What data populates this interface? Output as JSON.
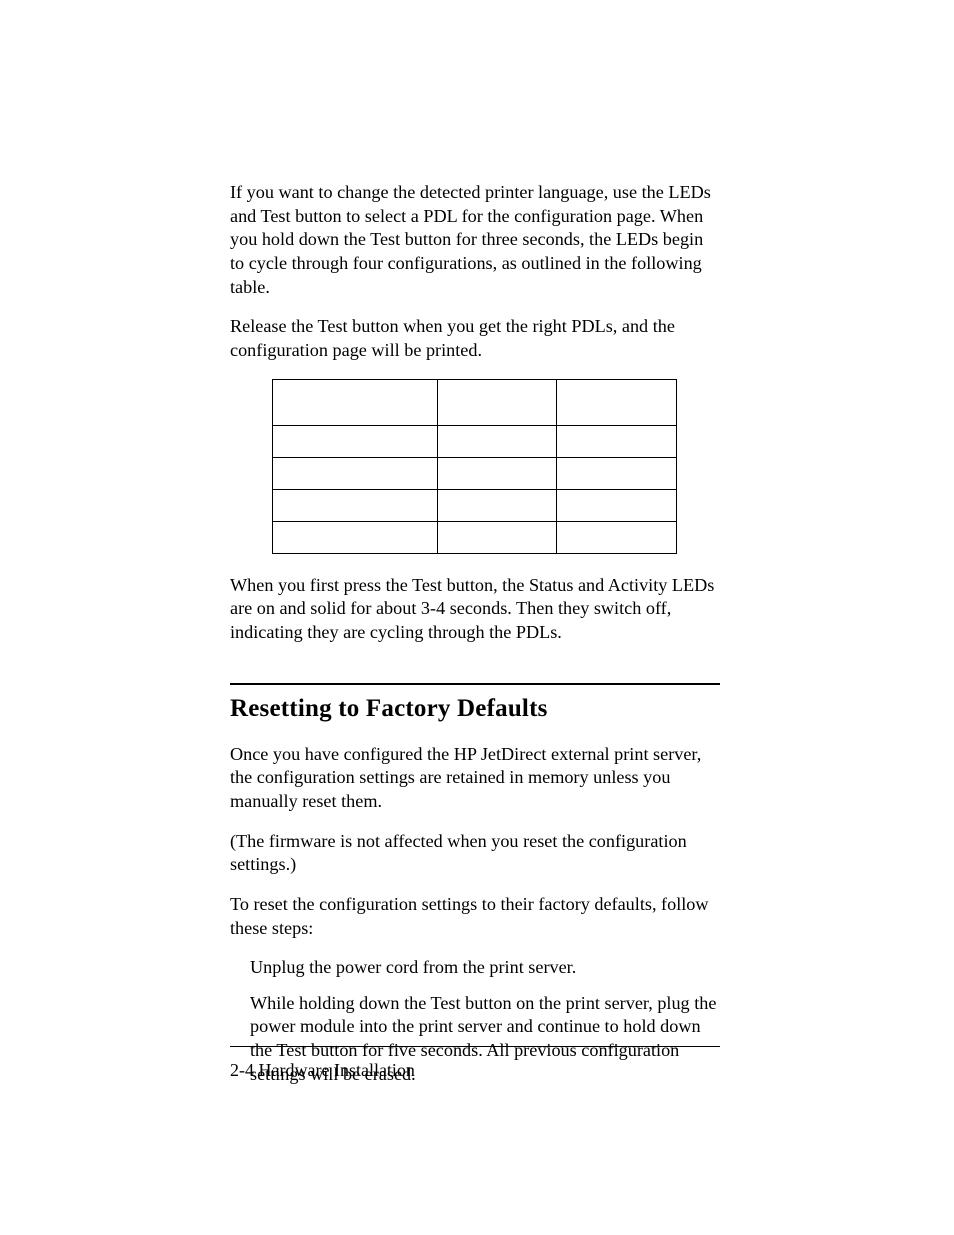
{
  "paragraphs": {
    "p1": "If you want to change the detected printer language, use the LEDs and Test button to select a PDL for the configuration page. When you hold down the Test button for three seconds, the LEDs begin to cycle through four configurations, as outlined in the following table.",
    "p2": "Release the Test button when you get the right PDLs, and the configuration page will be printed.",
    "p3": "When you first press the Test button, the Status and Activity LEDs are on and solid for about 3-4 seconds. Then they switch off, indicating they are cycling through the PDLs.",
    "p4": "Once you have configured the HP JetDirect external print server, the configuration settings are retained in memory unless you manually reset them.",
    "p5": "(The firmware is not affected when you reset the configuration settings.)",
    "p6": "To reset the configuration settings to their factory defaults, follow these steps:"
  },
  "table": {
    "headers": [
      "",
      "",
      ""
    ],
    "rows": [
      [
        "",
        "",
        ""
      ],
      [
        "",
        "",
        ""
      ],
      [
        "",
        "",
        ""
      ],
      [
        "",
        "",
        ""
      ]
    ]
  },
  "heading": "Resetting to Factory Defaults",
  "steps": {
    "s1": "Unplug the power cord from the print server.",
    "s2": "While holding down the Test button on the print server, plug the power module into the print server and continue to hold down the Test button for five seconds. All previous configuration settings will be erased."
  },
  "footer": "2-4 Hardware Installation"
}
